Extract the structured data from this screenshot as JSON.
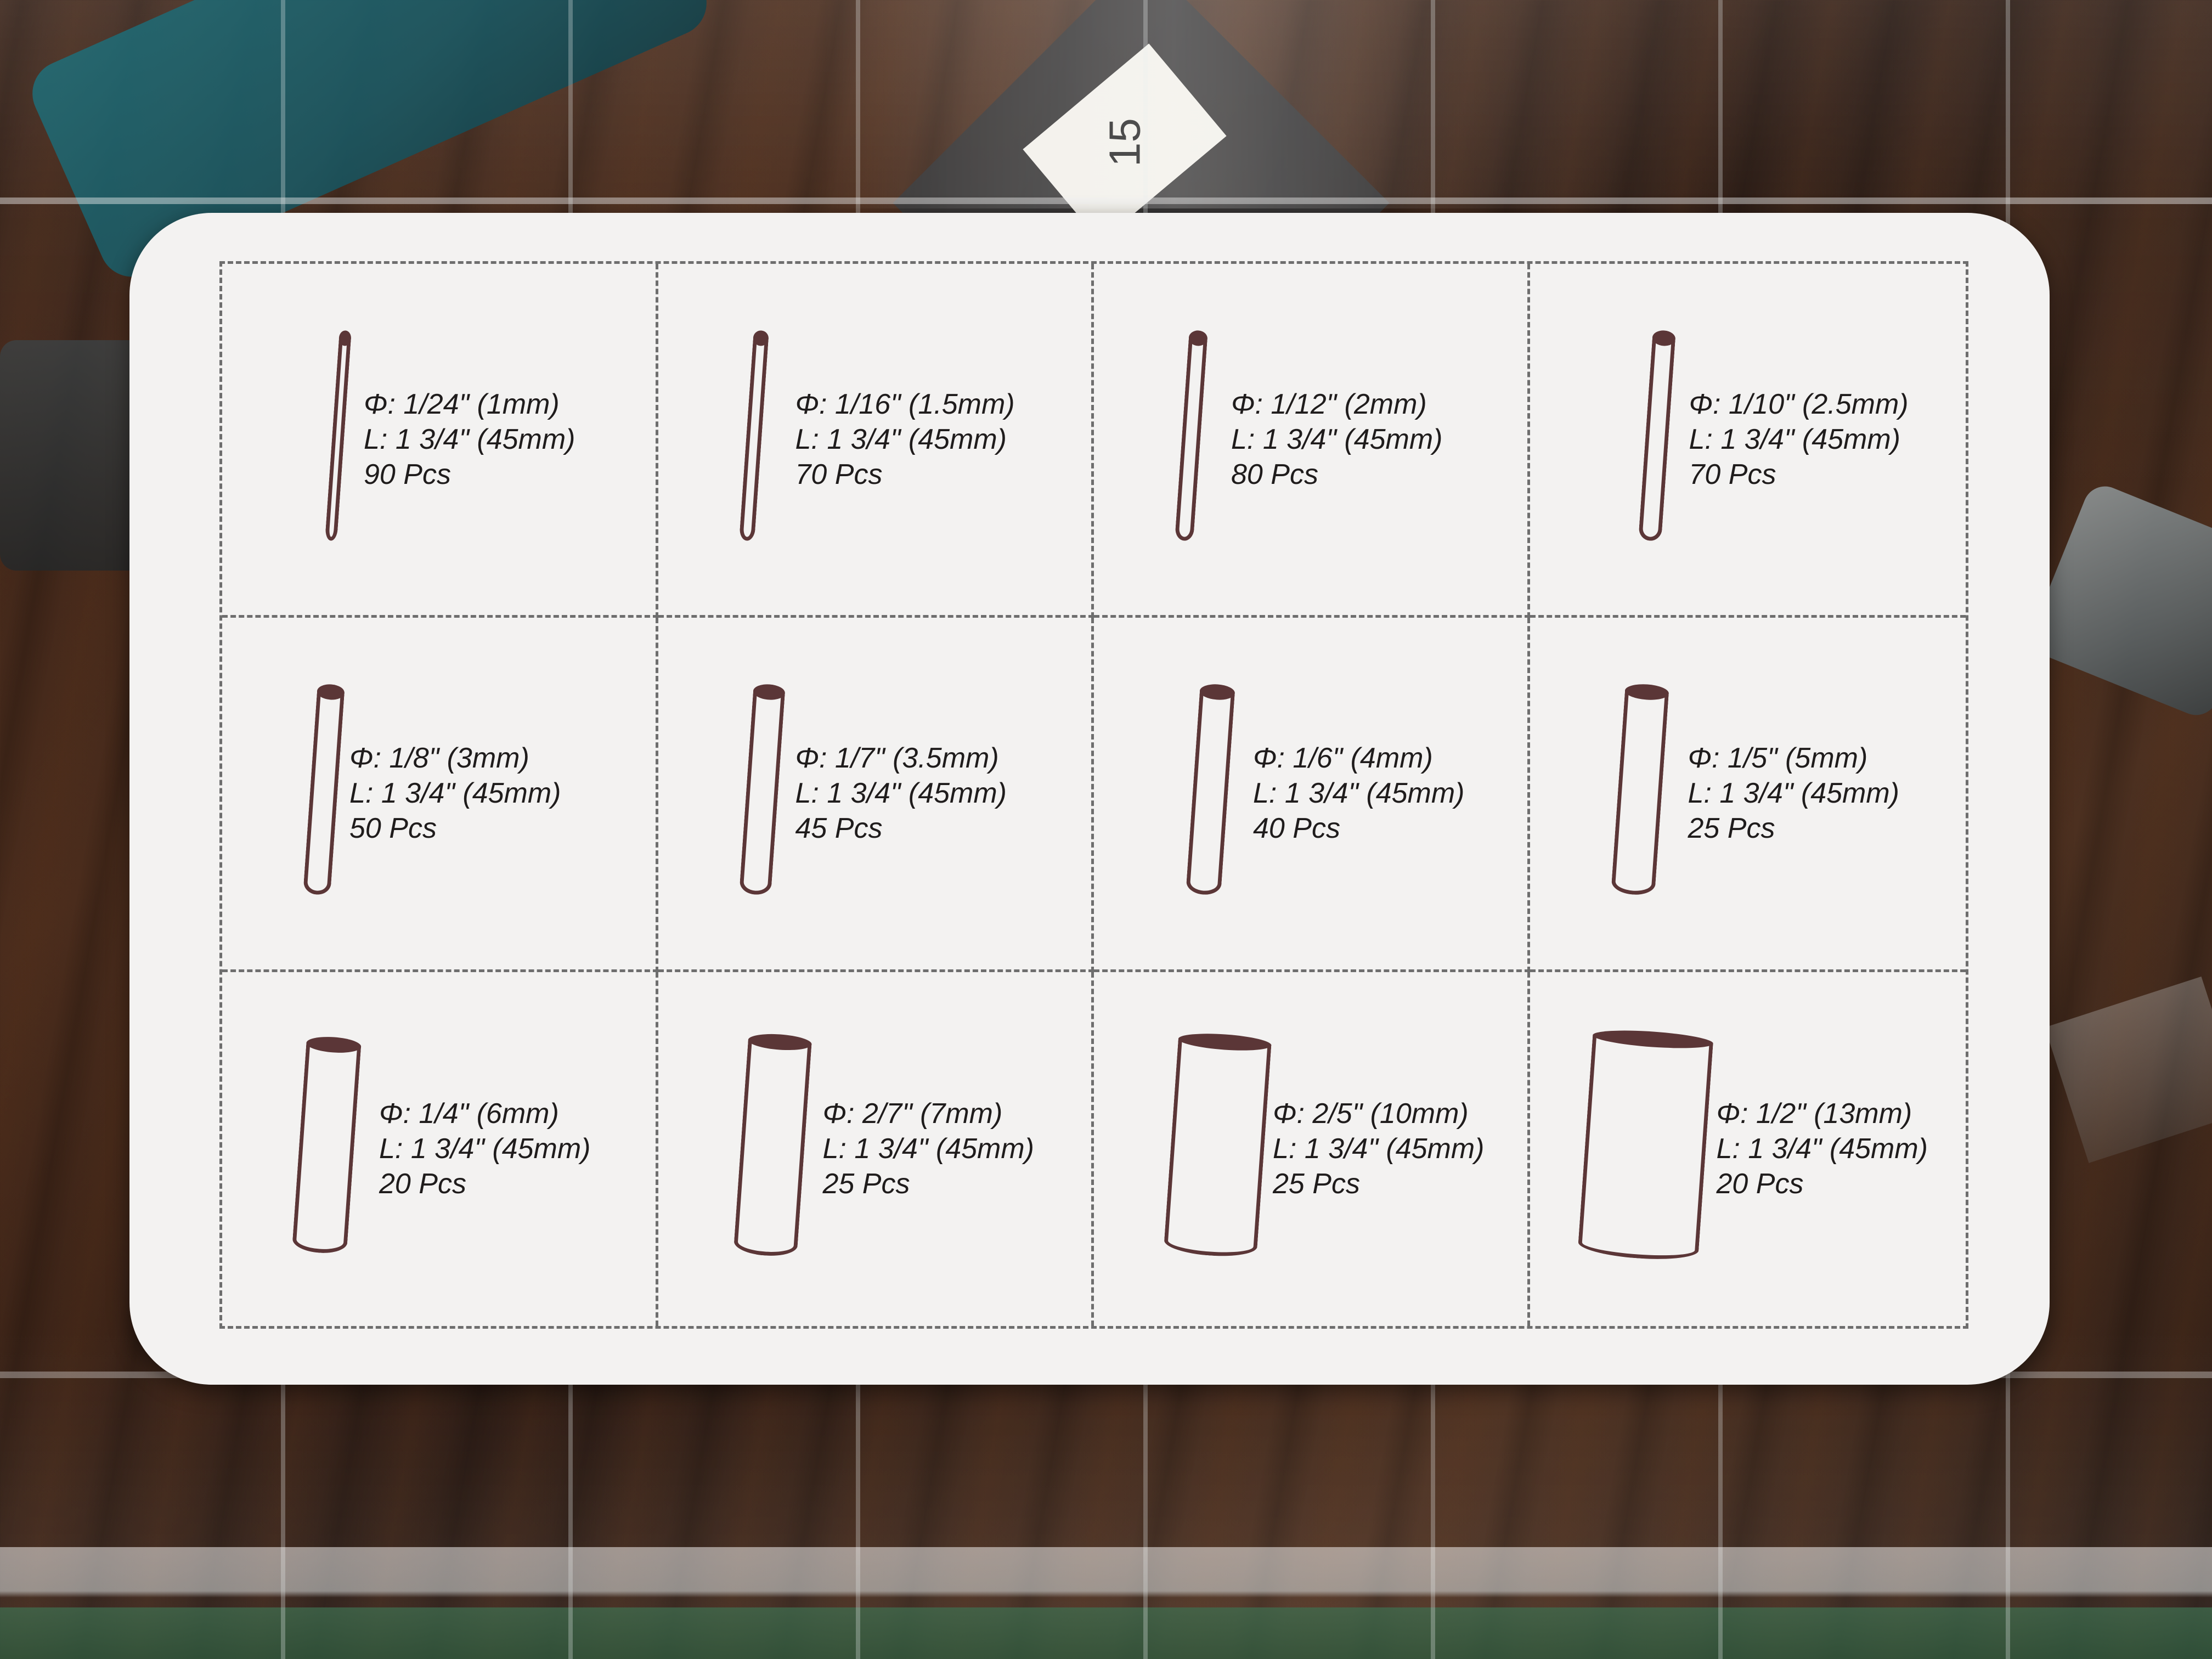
{
  "card": {
    "items": [
      {
        "diameter": "Φ: 1/24\" (1mm)",
        "length": "L: 1 3/4\" (45mm)",
        "count": "90 Pcs"
      },
      {
        "diameter": "Φ: 1/16\" (1.5mm)",
        "length": "L: 1 3/4\" (45mm)",
        "count": "70 Pcs"
      },
      {
        "diameter": "Φ: 1/12\" (2mm)",
        "length": "L: 1 3/4\" (45mm)",
        "count": "80 Pcs"
      },
      {
        "diameter": "Φ: 1/10\" (2.5mm)",
        "length": "L: 1 3/4\" (45mm)",
        "count": "70 Pcs"
      },
      {
        "diameter": "Φ: 1/8\" (3mm)",
        "length": "L: 1 3/4\" (45mm)",
        "count": "50 Pcs"
      },
      {
        "diameter": "Φ: 1/7\" (3.5mm)",
        "length": "L: 1 3/4\" (45mm)",
        "count": "45 Pcs"
      },
      {
        "diameter": "Φ: 1/6\" (4mm)",
        "length": "L: 1 3/4\" (45mm)",
        "count": "40 Pcs"
      },
      {
        "diameter": "Φ: 1/5\" (5mm)",
        "length": "L: 1 3/4\" (45mm)",
        "count": "25 Pcs"
      },
      {
        "diameter": "Φ: 1/4\" (6mm)",
        "length": "L: 1 3/4\" (45mm)",
        "count": "20 Pcs"
      },
      {
        "diameter": "Φ: 2/7\" (7mm)",
        "length": "L: 1 3/4\" (45mm)",
        "count": "25 Pcs"
      },
      {
        "diameter": "Φ: 2/5\" (10mm)",
        "length": "L: 1 3/4\" (45mm)",
        "count": "25 Pcs"
      },
      {
        "diameter": "Φ: 1/2\" (13mm)",
        "length": "L: 1 3/4\" (45mm)",
        "count": "20 Pcs"
      }
    ]
  },
  "background": {
    "tag_text": "15"
  },
  "colors": {
    "card": "#f3f2f1",
    "rod_outline": "#5b3637",
    "text": "#1f1c1c",
    "divider": "#6e6e6e"
  }
}
